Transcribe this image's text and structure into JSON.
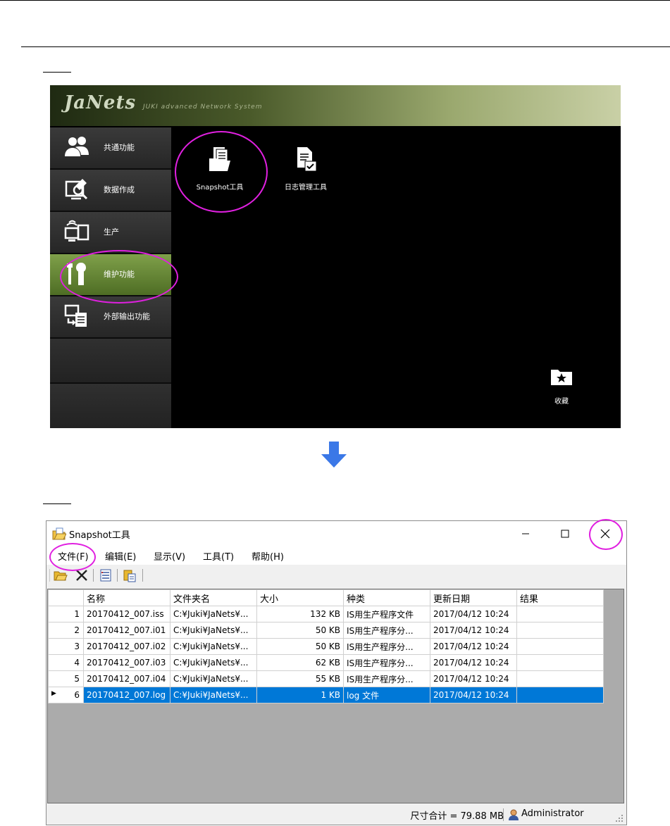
{
  "janets": {
    "logo": "JaNets",
    "tagline": "JUKI advanced Network System",
    "sidebar": [
      {
        "label": "共通功能",
        "icon": "users-icon"
      },
      {
        "label": "数据作成",
        "icon": "data-edit-icon"
      },
      {
        "label": "生产",
        "icon": "production-icon"
      },
      {
        "label": "维护功能",
        "icon": "wrench-icon",
        "active": true
      },
      {
        "label": "外部输出功能",
        "icon": "export-icon"
      }
    ],
    "apps": [
      {
        "label": "Snapshot工具",
        "icon": "snapshot-folder-icon"
      },
      {
        "label": "日志管理工具",
        "icon": "log-document-icon"
      }
    ],
    "favorites_label": "收藏"
  },
  "snapshot": {
    "title": "Snapshot工具",
    "menu": [
      "文件(F)",
      "编辑(E)",
      "显示(V)",
      "工具(T)",
      "帮助(H)"
    ],
    "columns": [
      "名称",
      "文件夹名",
      "大小",
      "种类",
      "更新日期",
      "结果"
    ],
    "rows": [
      {
        "no": "1",
        "name": "20170412_007.iss",
        "folder": "C:¥Juki¥JaNets¥...",
        "size": "132 KB",
        "kind": "IS用生产程序文件",
        "date": "2017/04/12 10:24",
        "result": ""
      },
      {
        "no": "2",
        "name": "20170412_007.i01",
        "folder": "C:¥Juki¥JaNets¥...",
        "size": "50 KB",
        "kind": "IS用生产程序分...",
        "date": "2017/04/12 10:24",
        "result": ""
      },
      {
        "no": "3",
        "name": "20170412_007.i02",
        "folder": "C:¥Juki¥JaNets¥...",
        "size": "50 KB",
        "kind": "IS用生产程序分...",
        "date": "2017/04/12 10:24",
        "result": ""
      },
      {
        "no": "4",
        "name": "20170412_007.i03",
        "folder": "C:¥Juki¥JaNets¥...",
        "size": "62 KB",
        "kind": "IS用生产程序分...",
        "date": "2017/04/12 10:24",
        "result": ""
      },
      {
        "no": "5",
        "name": "20170412_007.i04",
        "folder": "C:¥Juki¥JaNets¥...",
        "size": "55 KB",
        "kind": "IS用生产程序分...",
        "date": "2017/04/12 10:24",
        "result": ""
      },
      {
        "no": "6",
        "name": "20170412_007.log",
        "folder": "C:¥Juki¥JaNets¥...",
        "size": "1 KB",
        "kind": "log 文件",
        "date": "2017/04/12 10:24",
        "result": "",
        "selected": true
      }
    ],
    "status_total": "尺寸合计 = 79.88 MB",
    "status_user": "Administrator"
  },
  "colors": {
    "highlight_ellipse": "#e020e0",
    "selection": "#0078d7",
    "arrow": "#3b78e7",
    "active_menu_green": "#6b8c36"
  }
}
